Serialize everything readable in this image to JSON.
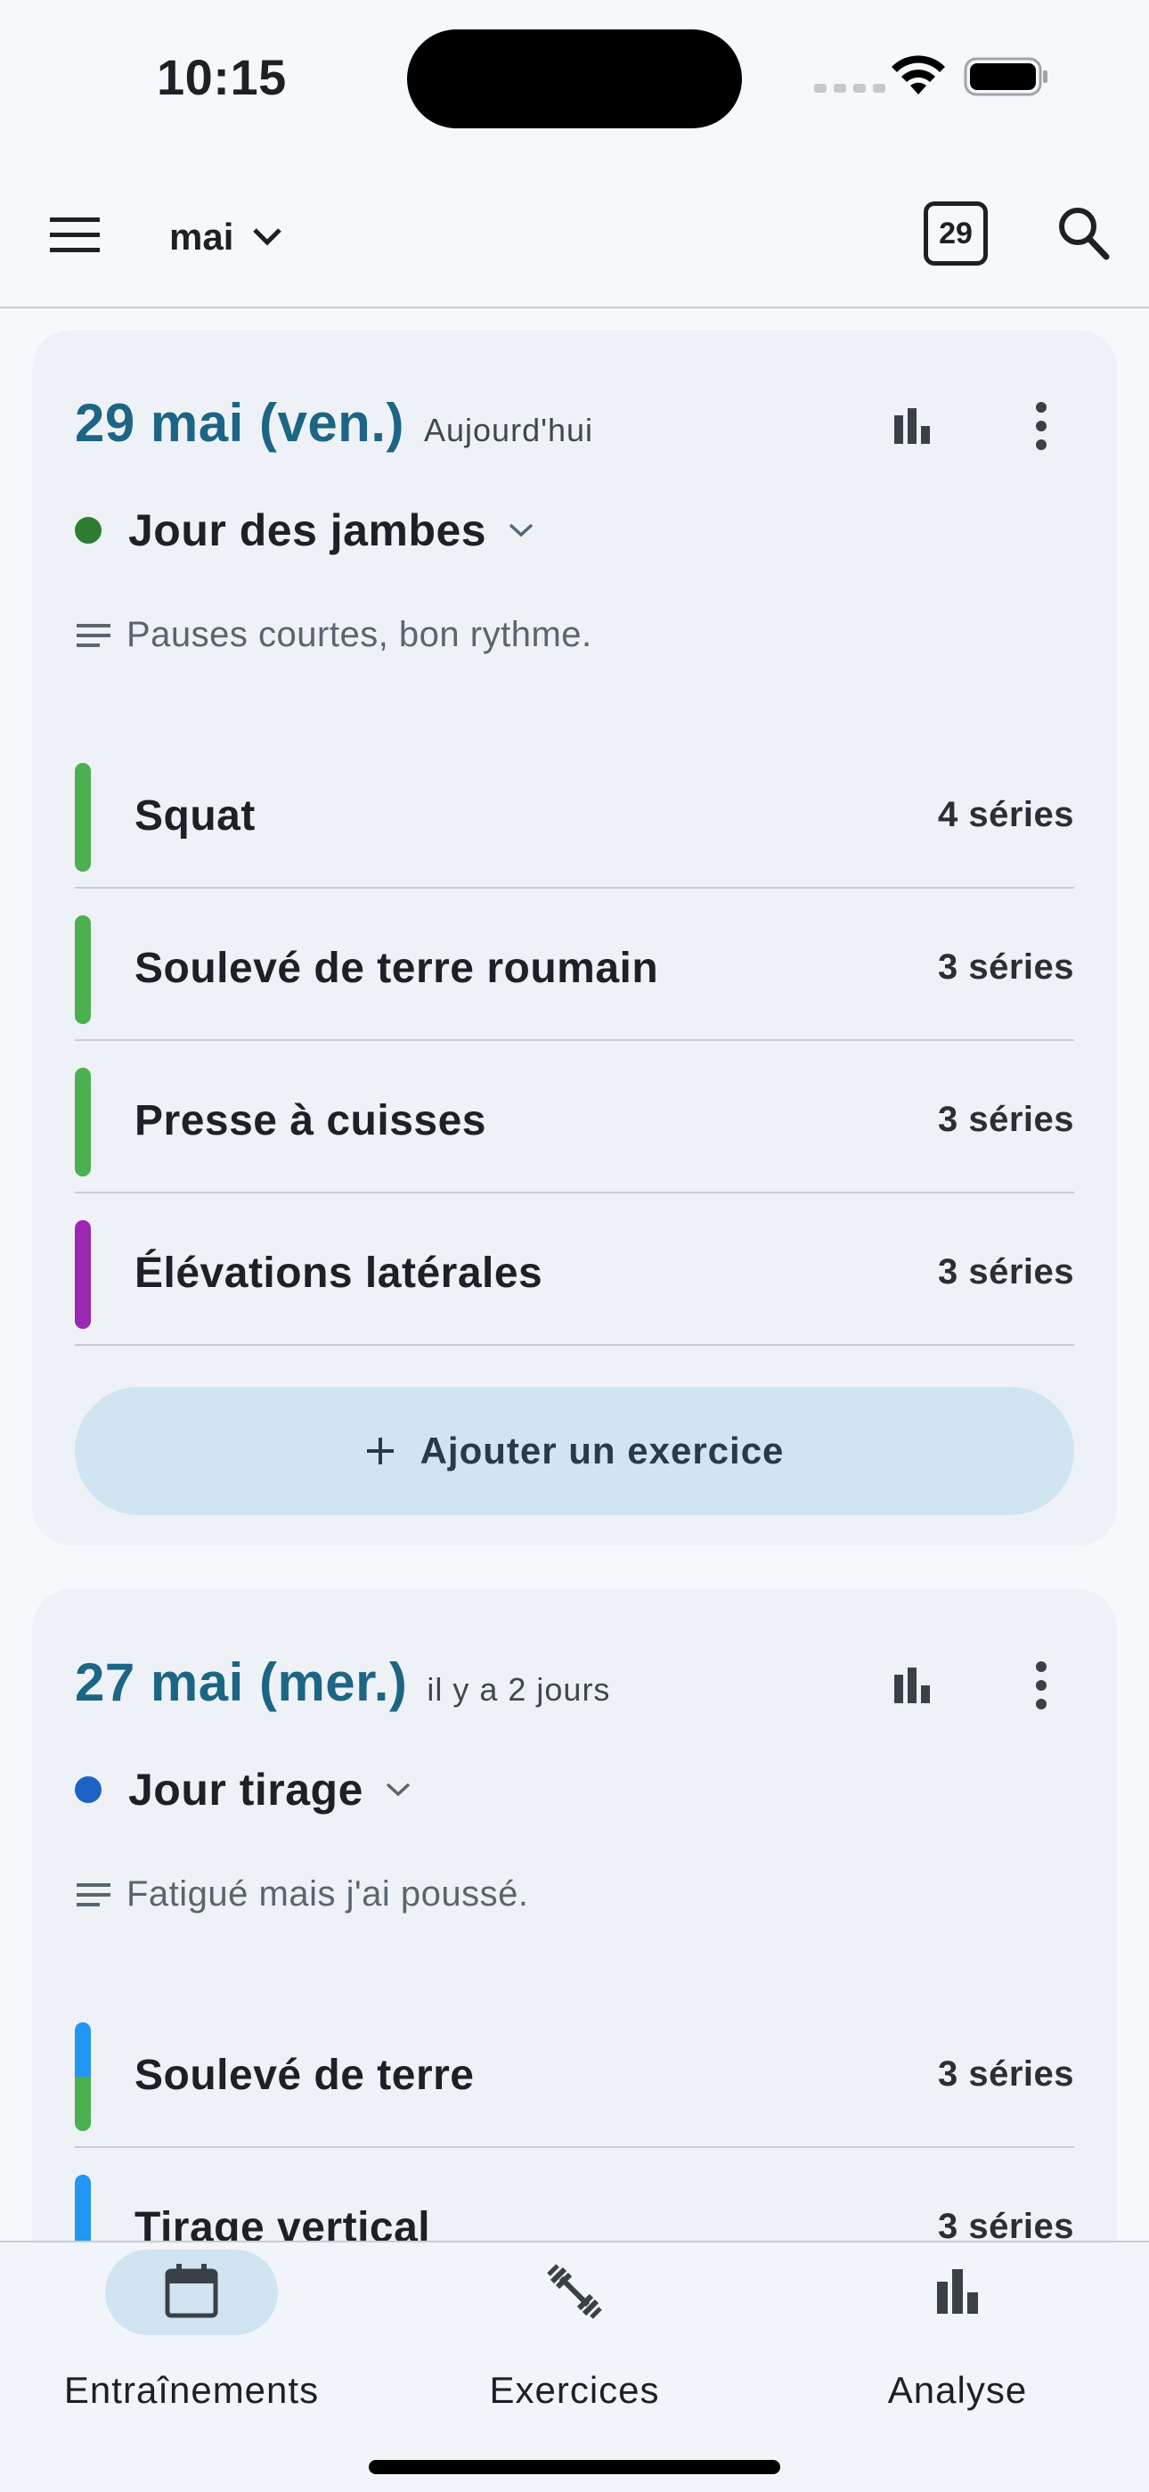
{
  "status_bar": {
    "time": "10:15"
  },
  "app_bar": {
    "month": "mai",
    "today_day": "29"
  },
  "workouts": [
    {
      "date": "29 mai (ven.)",
      "relative": "Aujourd'hui",
      "name": "Jour des jambes",
      "dot_color": "#2e7d32",
      "note": "Pauses courtes, bon rythme.",
      "exercises": [
        {
          "name": "Squat",
          "sets": "4 séries",
          "colors": [
            "#4caf50"
          ]
        },
        {
          "name": "Soulevé de terre roumain",
          "sets": "3 séries",
          "colors": [
            "#4caf50"
          ]
        },
        {
          "name": "Presse à cuisses",
          "sets": "3 séries",
          "colors": [
            "#4caf50"
          ]
        },
        {
          "name": "Élévations latérales",
          "sets": "3 séries",
          "colors": [
            "#9c27b0"
          ]
        }
      ],
      "add_label": "Ajouter un exercice"
    },
    {
      "date": "27 mai (mer.)",
      "relative": "il y a 2 jours",
      "name": "Jour tirage",
      "dot_color": "#1e63c4",
      "note": "Fatigué mais j'ai poussé.",
      "exercises": [
        {
          "name": "Soulevé de terre",
          "sets": "3 séries",
          "colors": [
            "#2196f3",
            "#4caf50"
          ]
        },
        {
          "name": "Tirage vertical",
          "sets": "3 séries",
          "colors": [
            "#2196f3"
          ]
        }
      ]
    }
  ],
  "bottom_nav": [
    {
      "label": "Entraînements",
      "icon": "calendar-icon",
      "active": true
    },
    {
      "label": "Exercices",
      "icon": "dumbbell-icon",
      "active": false
    },
    {
      "label": "Analyse",
      "icon": "bar-chart-icon",
      "active": false
    }
  ]
}
